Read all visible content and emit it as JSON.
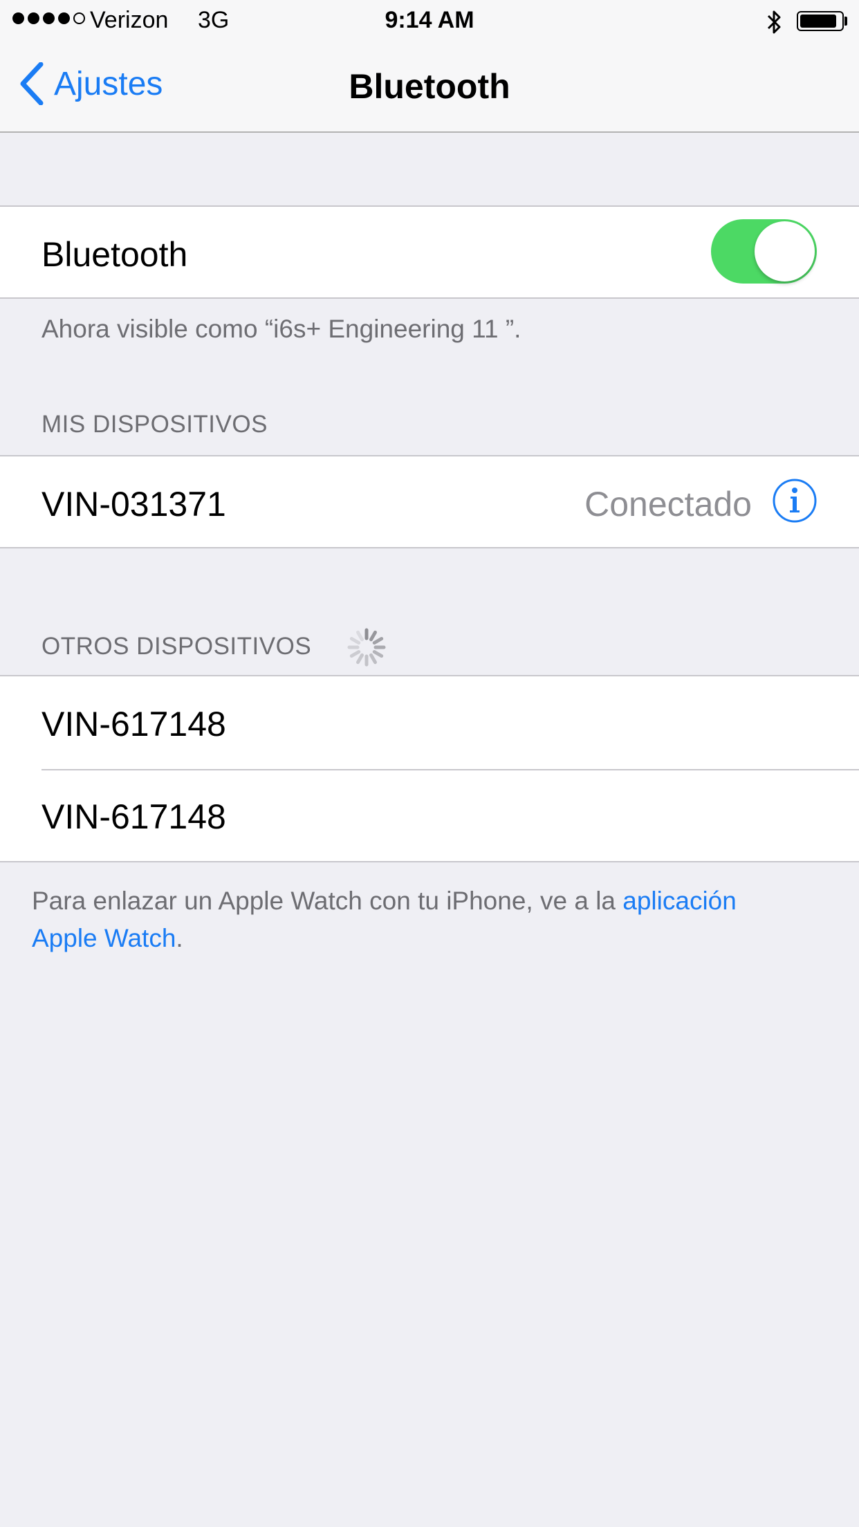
{
  "status_bar": {
    "signal_strength": "4 of 5",
    "carrier": "Verizon",
    "network": "3G",
    "time": "9:14 AM",
    "bluetooth_icon": "bluetooth-icon",
    "battery_level": 0.9
  },
  "nav": {
    "back_label": "Ajustes",
    "title": "Bluetooth"
  },
  "bluetooth": {
    "label": "Bluetooth",
    "enabled": true,
    "visible_as": "Ahora visible como “i6s+ Engineering 11 ”."
  },
  "my_devices": {
    "header": "MIS DISPOSITIVOS",
    "items": [
      {
        "name": "VIN-031371",
        "status": "Conectado",
        "info_icon": "info-icon"
      }
    ]
  },
  "other_devices": {
    "header": "OTROS DISPOSITIVOS",
    "spinner_icon": "spinner-icon",
    "items": [
      {
        "name": "VIN-617148"
      },
      {
        "name": "VIN-617148"
      }
    ]
  },
  "footer": {
    "text": "Para enlazar un Apple Watch con tu iPhone, ve a la ",
    "link_line1": "aplicación",
    "link_line2": "Apple Watch",
    "end": "."
  },
  "colors": {
    "accent": "#1a7cf4",
    "toggle_on": "#4cd964",
    "background": "#efeff4"
  }
}
